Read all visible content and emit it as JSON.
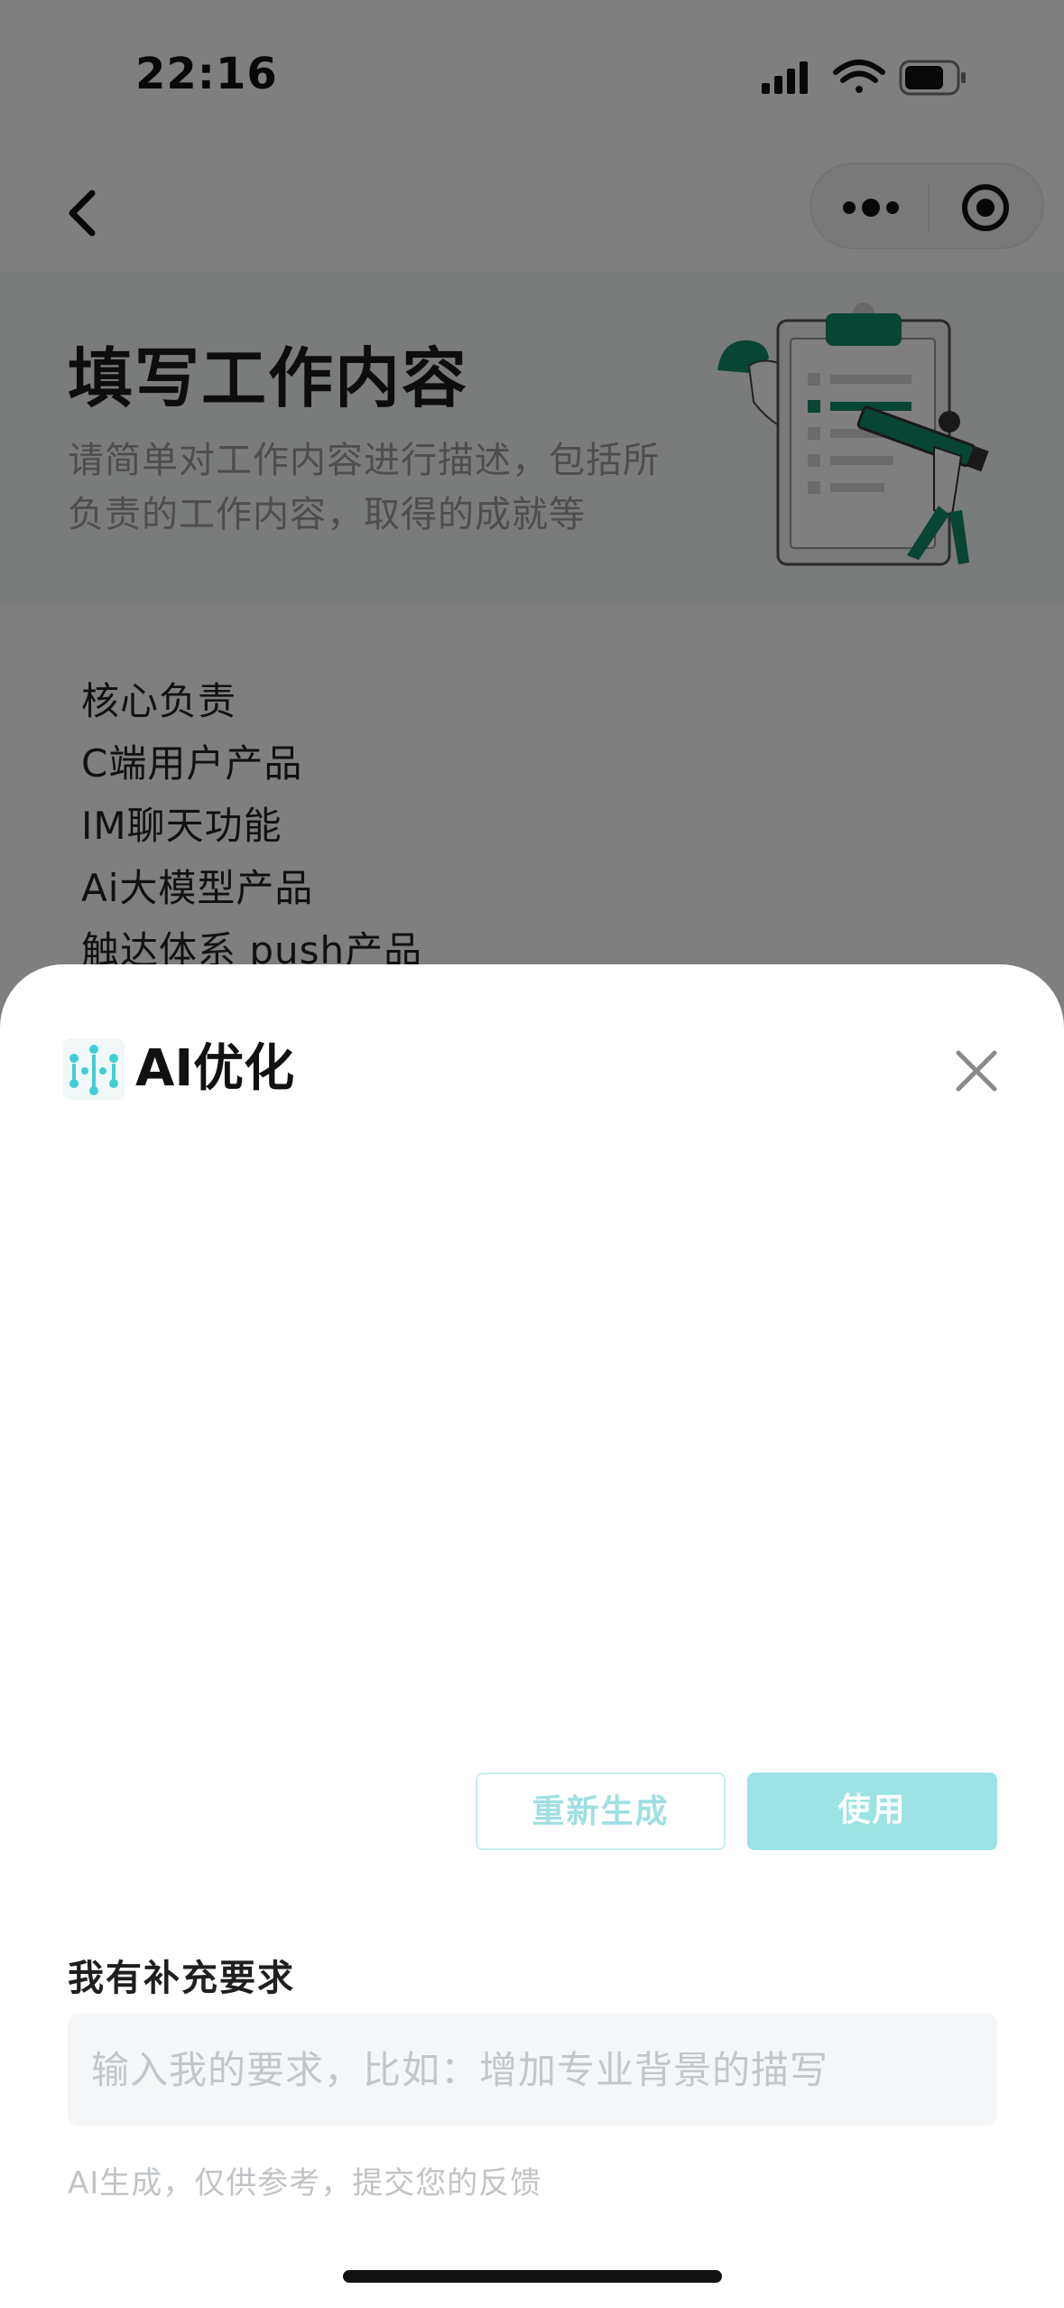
{
  "status_bar": {
    "time": "22:16",
    "icons": [
      "signal-icon",
      "wifi-icon",
      "battery-icon"
    ]
  },
  "nav": {
    "back_icon": "chevron-left-icon",
    "capsule_icons": [
      "more-dots-icon",
      "target-circle-icon"
    ]
  },
  "header": {
    "title": "填写工作内容",
    "subtitle": "请简单对工作内容进行描述，包括所负责的工作内容，取得的成就等"
  },
  "content": {
    "lines": [
      "核心负责",
      "C端用户产品",
      "IM聊天功能",
      "Ai大模型产品",
      "触达体系 push产品"
    ]
  },
  "sheet": {
    "title": "AI优化",
    "regen_label": "重新生成",
    "use_label": "使用",
    "requirement_label": "我有补充要求",
    "input_placeholder": "输入我的要求，比如：增加专业背景的描写",
    "input_value": "",
    "disclaimer": "AI生成，仅供参考，提交您的反馈"
  },
  "colors": {
    "accent_teal": "#3fcfd6",
    "use_button": "#9be3e5",
    "illustration_green": "#0f8a6a"
  }
}
